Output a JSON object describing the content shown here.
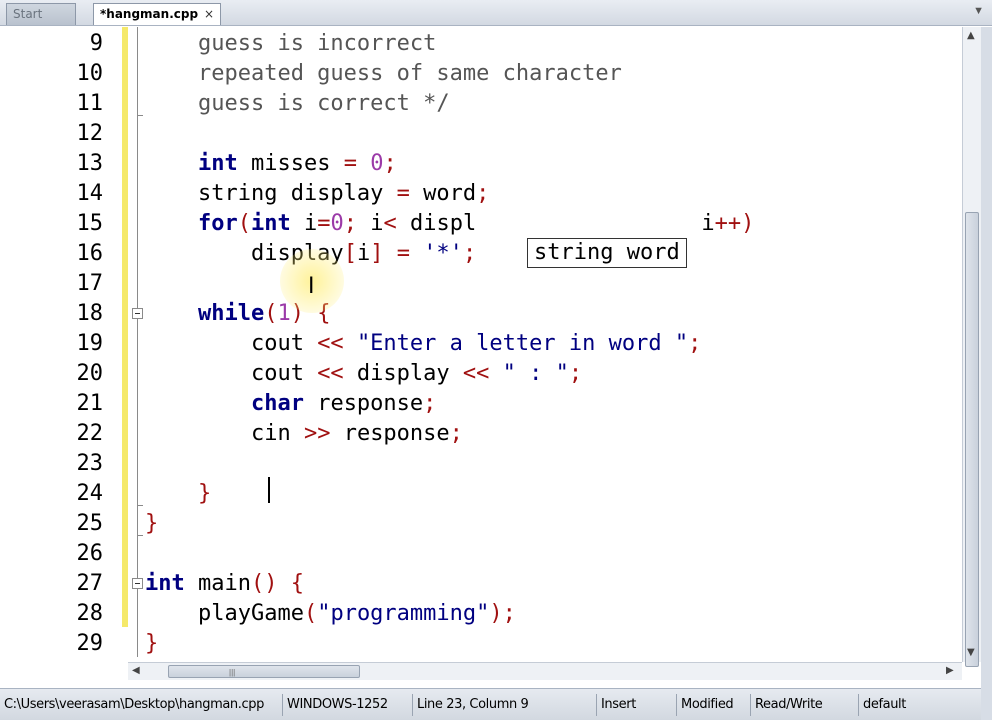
{
  "tabs": [
    {
      "label": "Start Here",
      "active": false
    },
    {
      "label": "*hangman.cpp",
      "active": true,
      "close": "×"
    }
  ],
  "editor": {
    "lines": [
      {
        "n": "9",
        "tokens": [
          {
            "t": "    guess is incorrect",
            "c": "cm"
          }
        ]
      },
      {
        "n": "10",
        "tokens": [
          {
            "t": "    repeated guess of same character",
            "c": "cm"
          }
        ]
      },
      {
        "n": "11",
        "tokens": [
          {
            "t": "    guess is correct */",
            "c": "cm"
          }
        ]
      },
      {
        "n": "12",
        "tokens": []
      },
      {
        "n": "13",
        "tokens": [
          {
            "t": "    "
          },
          {
            "t": "int",
            "c": "kw"
          },
          {
            "t": " misses "
          },
          {
            "t": "=",
            "c": "op"
          },
          {
            "t": " "
          },
          {
            "t": "0",
            "c": "num"
          },
          {
            "t": ";",
            "c": "op"
          }
        ]
      },
      {
        "n": "14",
        "tokens": [
          {
            "t": "    string display "
          },
          {
            "t": "=",
            "c": "op"
          },
          {
            "t": " word"
          },
          {
            "t": ";",
            "c": "op"
          }
        ]
      },
      {
        "n": "15",
        "tokens": [
          {
            "t": "    "
          },
          {
            "t": "for",
            "c": "kw"
          },
          {
            "t": "(",
            "c": "op"
          },
          {
            "t": "int",
            "c": "kw"
          },
          {
            "t": " i"
          },
          {
            "t": "=",
            "c": "op"
          },
          {
            "t": "0",
            "c": "num"
          },
          {
            "t": ";",
            "c": "op"
          },
          {
            "t": " i"
          },
          {
            "t": "<",
            "c": "op"
          },
          {
            "t": " displ"
          },
          {
            "t": "                 "
          },
          {
            "t": "i"
          },
          {
            "t": "++)",
            "c": "op"
          }
        ]
      },
      {
        "n": "16",
        "tokens": [
          {
            "t": "        display"
          },
          {
            "t": "[",
            "c": "op"
          },
          {
            "t": "i"
          },
          {
            "t": "]",
            "c": "op"
          },
          {
            "t": " "
          },
          {
            "t": "=",
            "c": "op"
          },
          {
            "t": " "
          },
          {
            "t": "'*'",
            "c": "str"
          },
          {
            "t": ";",
            "c": "op"
          }
        ]
      },
      {
        "n": "17",
        "tokens": []
      },
      {
        "n": "18",
        "tokens": [
          {
            "t": "    "
          },
          {
            "t": "while",
            "c": "kw"
          },
          {
            "t": "(",
            "c": "op"
          },
          {
            "t": "1",
            "c": "num"
          },
          {
            "t": ")",
            "c": "op"
          },
          {
            "t": " "
          },
          {
            "t": "{",
            "c": "op"
          }
        ]
      },
      {
        "n": "19",
        "tokens": [
          {
            "t": "        cout "
          },
          {
            "t": "<<",
            "c": "op"
          },
          {
            "t": " "
          },
          {
            "t": "\"Enter a letter in word \"",
            "c": "str"
          },
          {
            "t": ";",
            "c": "op"
          }
        ]
      },
      {
        "n": "20",
        "tokens": [
          {
            "t": "        cout "
          },
          {
            "t": "<<",
            "c": "op"
          },
          {
            "t": " display "
          },
          {
            "t": "<<",
            "c": "op"
          },
          {
            "t": " "
          },
          {
            "t": "\" : \"",
            "c": "str"
          },
          {
            "t": ";",
            "c": "op"
          }
        ]
      },
      {
        "n": "21",
        "tokens": [
          {
            "t": "        "
          },
          {
            "t": "char",
            "c": "kw"
          },
          {
            "t": " response"
          },
          {
            "t": ";",
            "c": "op"
          }
        ]
      },
      {
        "n": "22",
        "tokens": [
          {
            "t": "        cin "
          },
          {
            "t": ">>",
            "c": "op"
          },
          {
            "t": " response"
          },
          {
            "t": ";",
            "c": "op"
          }
        ]
      },
      {
        "n": "23",
        "tokens": []
      },
      {
        "n": "24",
        "tokens": [
          {
            "t": "    "
          },
          {
            "t": "}",
            "c": "op"
          }
        ]
      },
      {
        "n": "25",
        "tokens": [
          {
            "t": "}",
            "c": "op"
          }
        ]
      },
      {
        "n": "26",
        "tokens": []
      },
      {
        "n": "27",
        "tokens": [
          {
            "t": "int",
            "c": "kw"
          },
          {
            "t": " main"
          },
          {
            "t": "()",
            "c": "op"
          },
          {
            "t": " "
          },
          {
            "t": "{",
            "c": "op"
          }
        ]
      },
      {
        "n": "28",
        "tokens": [
          {
            "t": "    playGame"
          },
          {
            "t": "(",
            "c": "op"
          },
          {
            "t": "\"programming\"",
            "c": "str"
          },
          {
            "t": ");",
            "c": "op"
          }
        ]
      },
      {
        "n": "29",
        "tokens": [
          {
            "t": "}",
            "c": "op"
          }
        ]
      }
    ],
    "tooltip": "string word"
  },
  "statusbar": {
    "path": "C:\\Users\\veerasam\\Desktop\\hangman.cpp",
    "encoding": "WINDOWS-1252",
    "position": "Line 23, Column 9",
    "mode": "Insert",
    "modified": "Modified",
    "access": "Read/Write",
    "syntax": "default"
  }
}
